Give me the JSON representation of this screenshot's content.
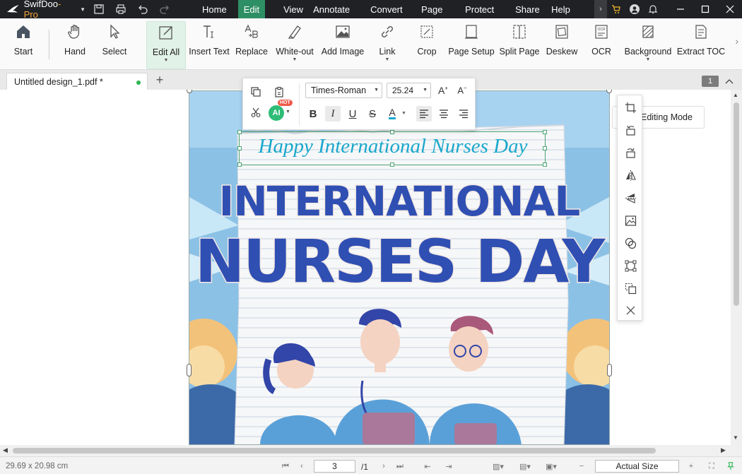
{
  "app": {
    "brand_name": "SwifDoo",
    "brand_suffix": "-Pro"
  },
  "menu": {
    "items": [
      "Home",
      "Edit",
      "View",
      "Annotate",
      "Convert",
      "Page",
      "Protect",
      "Share",
      "Help"
    ],
    "active": "Edit"
  },
  "ribbon": {
    "buttons": [
      {
        "label": "Start",
        "icon": "home-icon"
      },
      {
        "label": "Hand",
        "icon": "hand-icon"
      },
      {
        "label": "Select",
        "icon": "cursor-icon"
      },
      {
        "label": "Edit All",
        "icon": "edit-all-icon"
      },
      {
        "label": "Insert Text",
        "icon": "insert-text-icon"
      },
      {
        "label": "Replace",
        "icon": "replace-icon"
      },
      {
        "label": "White-out",
        "icon": "white-out-icon"
      },
      {
        "label": "Add Image",
        "icon": "image-icon"
      },
      {
        "label": "Link",
        "icon": "link-icon"
      },
      {
        "label": "Crop",
        "icon": "crop-icon"
      },
      {
        "label": "Page Setup",
        "icon": "page-setup-icon"
      },
      {
        "label": "Split Page",
        "icon": "split-page-icon"
      },
      {
        "label": "Deskew",
        "icon": "deskew-icon"
      },
      {
        "label": "OCR",
        "icon": "ocr-icon"
      },
      {
        "label": "Background",
        "icon": "background-icon"
      },
      {
        "label": "Extract TOC",
        "icon": "extract-toc-icon"
      }
    ]
  },
  "tabs": {
    "document_tab": "Untitled design_1.pdf *",
    "page_badge": "1"
  },
  "format_toolbar": {
    "font_family": "Times-Roman",
    "font_size": "25.24",
    "ai_label": "AI",
    "hot_label": "HOT",
    "bold": "B",
    "italic": "I",
    "underline": "U",
    "strike": "S",
    "color": "A"
  },
  "editing_mode": {
    "label": "Editing Mode"
  },
  "document": {
    "selected_text": "Happy International Nurses Day",
    "title_line1": "INTERNATIONAL",
    "title_line2": "NURSES DAY"
  },
  "status": {
    "dimensions": "29.69 x 20.98 cm",
    "current_page": "3",
    "total_pages": "/1",
    "zoom": "Actual Size"
  },
  "colors": {
    "accent": "#2f8f64",
    "titlebar": "#1f2125",
    "text_blue": "#1aa7cc",
    "title_blue": "#2f4fb2"
  }
}
